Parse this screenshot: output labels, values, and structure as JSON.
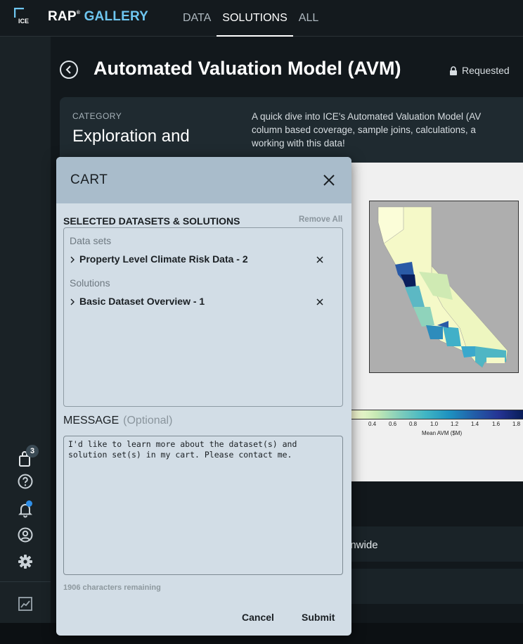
{
  "header": {
    "logo_text": "ICE",
    "brand_rap": "RAP",
    "brand_tm": "®",
    "brand_gallery": "GALLERY",
    "nav": [
      {
        "label": "DATA",
        "active": false
      },
      {
        "label": "SOLUTIONS",
        "active": true
      },
      {
        "label": "ALL",
        "active": false
      }
    ]
  },
  "sidebar": {
    "cart_count": "3",
    "icons": [
      "cart-icon",
      "help-icon",
      "bell-icon",
      "account-icon",
      "settings-icon",
      "chart-icon"
    ]
  },
  "page": {
    "title": "Automated Valuation Model (AVM)",
    "status": "Requested",
    "category_label": "CATEGORY",
    "category_value": "Exploration and",
    "description": "A quick dive into ICE's Automated Valuation Model (AV\ncolumn based coverage, sample joins, calculations, a\nworking with this data!",
    "row_text": "onwide"
  },
  "map": {
    "colorbar_ticks": [
      "0.4",
      "0.6",
      "0.8",
      "1.0",
      "1.2",
      "1.4",
      "1.6",
      "1.8"
    ],
    "colorbar_label": "Mean AVM ($M)"
  },
  "cart": {
    "title": "CART",
    "selected_title": "SELECTED DATASETS & SOLUTIONS",
    "remove_all": "Remove All",
    "datasets_label": "Data sets",
    "datasets": [
      {
        "name": "Property Level Climate Risk Data - 2"
      }
    ],
    "solutions_label": "Solutions",
    "solutions": [
      {
        "name": "Basic Dataset Overview - 1"
      }
    ],
    "message_label": "MESSAGE",
    "message_optional": "(Optional)",
    "message_value": "I'd like to learn more about the dataset(s) and solution set(s) in my cart. Please contact me.",
    "remaining": "1906 characters remaining",
    "cancel": "Cancel",
    "submit": "Submit"
  },
  "colors": {
    "accent": "#6ec6f0",
    "notification": "#2f8fe8",
    "cart_header": "#a9bccb",
    "cart_body": "#d2dde6"
  }
}
